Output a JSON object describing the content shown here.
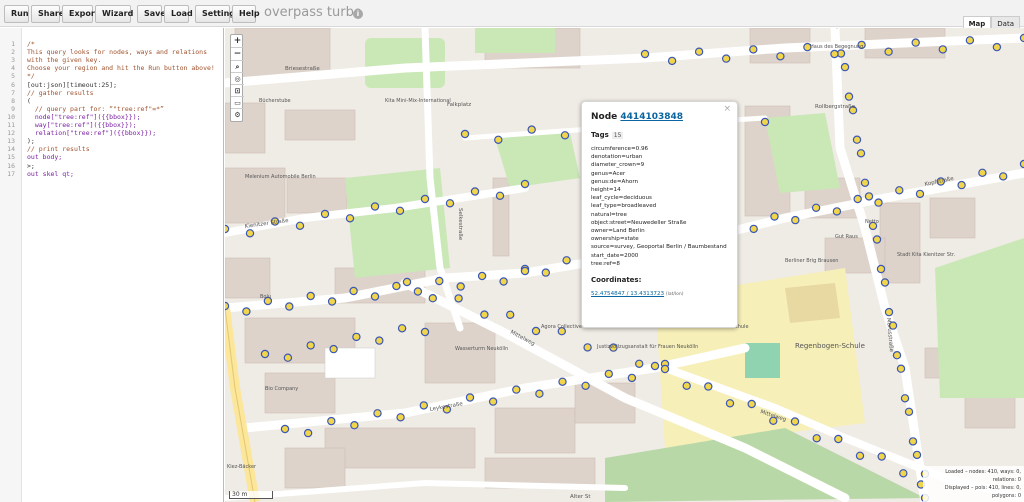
{
  "toolbar": {
    "buttons": [
      "Run",
      "Share",
      "Export",
      "Wizard",
      "Save",
      "Load",
      "Settings",
      "Help"
    ],
    "app_title": "overpass turbo",
    "view_tabs": [
      "Map",
      "Data"
    ]
  },
  "editor": {
    "line_numbers": [
      "1",
      "2",
      "3",
      "4",
      "5",
      "6",
      "7",
      "8",
      "9",
      "10",
      "11",
      "12",
      "13",
      "14",
      "15",
      "16",
      "17"
    ],
    "lines": [
      {
        "kind": "comment",
        "text": "/*"
      },
      {
        "kind": "comment",
        "text": "This query looks for nodes, ways and relations"
      },
      {
        "kind": "comment",
        "text": "with the given key."
      },
      {
        "kind": "comment",
        "text": "Choose your region and hit the Run button above!"
      },
      {
        "kind": "comment",
        "text": "*/"
      },
      {
        "kind": "code",
        "text": "[out:json][timeout:25];"
      },
      {
        "kind": "comment",
        "text": "// gather results"
      },
      {
        "kind": "code",
        "text": "("
      },
      {
        "kind": "comment",
        "text": "  // query part for: “\"tree:ref\"=*”"
      },
      {
        "kind": "kw",
        "text": "  node[\"tree:ref\"]({{bbox}});"
      },
      {
        "kind": "kw",
        "text": "  way[\"tree:ref\"]({{bbox}});"
      },
      {
        "kind": "kw",
        "text": "  relation[\"tree:ref\"]({{bbox}});"
      },
      {
        "kind": "code",
        "text": ");"
      },
      {
        "kind": "comment",
        "text": "// print results"
      },
      {
        "kind": "kw",
        "text": "out body;"
      },
      {
        "kind": "code",
        "text": ">;"
      },
      {
        "kind": "kw",
        "text": "out skel qt;"
      }
    ]
  },
  "map": {
    "zoom_in": "+",
    "zoom_out": "−",
    "scale_label": "30 m",
    "street_labels": [
      "Briesestraße",
      "Kienitzer Straße",
      "Rollbergstraße",
      "Falkplatz",
      "Selkestraße",
      "Kopfstraße",
      "Mittelweg",
      "Leykestraße",
      "Morusstraße",
      "Mittelweg",
      "Alter St"
    ],
    "poi_labels": [
      "Kita Mini-Mix-International",
      "Bücherstube",
      "Melenium Automobile Berlin",
      "Agora Collective",
      "Wasserturm Neukölln",
      "Justizvollzugsanstalt für Frauen Neukölln",
      "Elisabeth-Schule",
      "Regenbogen-Schule",
      "Berliner Brig Brausen",
      "Stadt Kita Kienitzer Str.",
      "Gut Raus",
      "Bio Company",
      "Bolu",
      "Kiez-Bäcker",
      "Netto",
      "Haus des Begegnung"
    ]
  },
  "popup": {
    "close": "×",
    "node_label": "Node",
    "node_id": "4414103848",
    "tags_heading": "Tags",
    "tags_count": "15",
    "tags": [
      "circumference=0.96",
      "denotation=urban",
      "diameter_crown=9",
      "genus=Acer",
      "genus:de=Ahorn",
      "height=14",
      "leaf_cycle=deciduous",
      "leaf_type=broadleaved",
      "natural=tree",
      "object:street=Neuwedeller Straße",
      "owner=Land Berlin",
      "ownership=state",
      "source=survey, Geoportal Berlin / Baumbestand",
      "start_date=2000",
      "tree:ref=8"
    ],
    "coordinates_heading": "Coordinates:",
    "coordinates": "52.4754847 / 13.4313723",
    "coordinates_note": "(lat/lon)"
  },
  "stats": {
    "loaded": "Loaded – nodes: 410, ways: 0, relations: 0",
    "displayed": "Displayed – pois: 410, lines: 0, polygons: 0"
  },
  "colors": {
    "node_fill": "#f1d54a",
    "node_stroke": "#3b57b5",
    "park": "#c7e7b4",
    "road": "#ffffff",
    "building": "#d9d0c9"
  }
}
